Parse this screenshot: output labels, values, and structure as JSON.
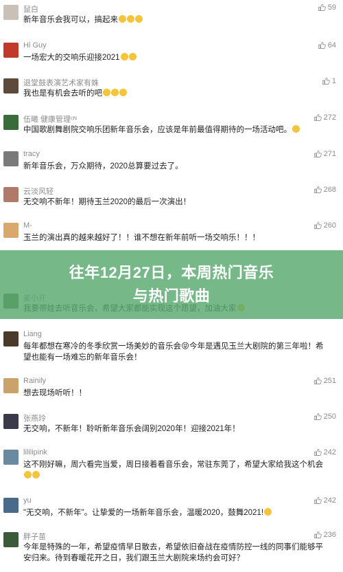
{
  "banner": {
    "line1": "往年12月27日，本周热门音乐",
    "line2": "与热门歌曲"
  },
  "comments": [
    {
      "user": "鼠白",
      "text": "新年音乐会我可以，搞起来",
      "likes": "59",
      "emoji_count": 3,
      "avatar_color": "#c9c1b8"
    },
    {
      "user": "Hi Guy",
      "text": "一场宏大的交响乐迎接2021",
      "likes": "64",
      "emoji_count": 2,
      "avatar_color": "#c0392b"
    },
    {
      "user": "退堂鼓表演艺术家有姝",
      "text": "我也是有机会去听的吧",
      "likes": "1",
      "emoji_count": 3,
      "avatar_color": "#5d4a3a"
    },
    {
      "user": "伍曦 健康管理ᶜᴺ",
      "text": "中国歌剧舞剧院交响乐团新年音乐会，应该是年前最值得期待的一场活动吧。",
      "likes": "272",
      "emoji_count": 1,
      "avatar_color": "#3a6b3a"
    },
    {
      "user": "tracy",
      "text": "新年音乐会，万众期待，2020总算要过去了。",
      "likes": "271",
      "emoji_count": 0,
      "avatar_color": "#7a7a7a"
    },
    {
      "user": "云淡风轻",
      "text": "无交响不新年！期待玉兰2020的最后一次演出！",
      "likes": "268",
      "emoji_count": 0,
      "avatar_color": "#b07a6a"
    },
    {
      "user": "M-",
      "text": "玉兰的演出真的越来越好了！！谁不想在新年前听一场交响乐！！！",
      "likes": "260",
      "emoji_count": 0,
      "avatar_color": "#d9a86c"
    },
    {
      "user": "",
      "text": "",
      "likes": "",
      "emoji_count": 0,
      "avatar_color": "#6c8a5a"
    },
    {
      "user": "姜小开",
      "text": "我要带娃去听音乐会，希望大家都能实现这个愿望，加油大家",
      "likes": "",
      "emoji_count": 1,
      "avatar_color": "#5a7a4a"
    },
    {
      "user": "Liang",
      "text": "每年都想在寒冷的冬季欣赏一场美妙的音乐会😝今年是遇见玉兰大剧院的第三年啦！希望也能有一场难忘的新年音乐会！",
      "likes": "",
      "emoji_count": 0,
      "avatar_color": "#4a3a2a"
    },
    {
      "user": "Rainily",
      "text": "想去现场听听！！",
      "likes": "251",
      "emoji_count": 0,
      "avatar_color": "#c9a36a"
    },
    {
      "user": "张燕玲",
      "text": "无交响，不新年！聆听新年音乐会阔别2020年！迎接2021年！",
      "likes": "250",
      "emoji_count": 0,
      "avatar_color": "#3a3a4a"
    },
    {
      "user": "lililipink",
      "text": "这不刚好嘛，周六看完当爱，周日接着看音乐会，常驻东莞了，希望大家给我这个机会",
      "likes": "242",
      "emoji_count": 2,
      "avatar_color": "#6a8aa0"
    },
    {
      "user": "yu",
      "text": "\"无交响，不新年\"。让挚爱的一场新年音乐会，温暖2020，鼓舞2021!",
      "likes": "242",
      "emoji_count": 1,
      "avatar_color": "#4a6a8a"
    },
    {
      "user": "胖子苗",
      "text": "今年是特殊的一年，希望疫情早日散去，希望依旧奋战在疫情防控一线的同事们能够平安归来。待到春暖花开之日，我们跟玉兰大剧院来场约会可好？",
      "likes": "236",
      "emoji_count": 0,
      "avatar_color": "#3a5a3a"
    }
  ],
  "colors": {
    "banner_bg": "#58a86e",
    "like_gray": "#8b8b8b",
    "emoji": "#f4c53a"
  },
  "icons": {
    "like": "thumbs-up-icon"
  }
}
